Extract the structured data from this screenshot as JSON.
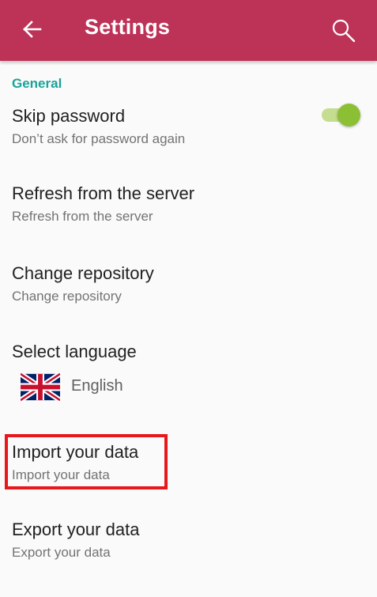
{
  "appbar": {
    "title": "Settings",
    "back_icon": "arrow-left-icon",
    "search_icon": "search-icon",
    "color": "#bd3257"
  },
  "general": {
    "header": "General",
    "header_color": "#1aa39a"
  },
  "prefs": {
    "skip_password": {
      "title": "Skip password",
      "summary": "Don’t ask for password again",
      "enabled": true,
      "toggle_color": "#8bc034"
    },
    "refresh": {
      "title": "Refresh from the server",
      "summary": "Refresh from the server"
    },
    "change_repo": {
      "title": "Change repository",
      "summary": "Change repository"
    },
    "language": {
      "title": "Select language",
      "value": "English",
      "flag_icon": "uk-flag-icon"
    },
    "import": {
      "title": "Import your data",
      "summary": "Import your data"
    },
    "export": {
      "title": "Export your data",
      "summary": "Export your data"
    }
  },
  "annotation": {
    "highlight_color": "#e8171c"
  }
}
